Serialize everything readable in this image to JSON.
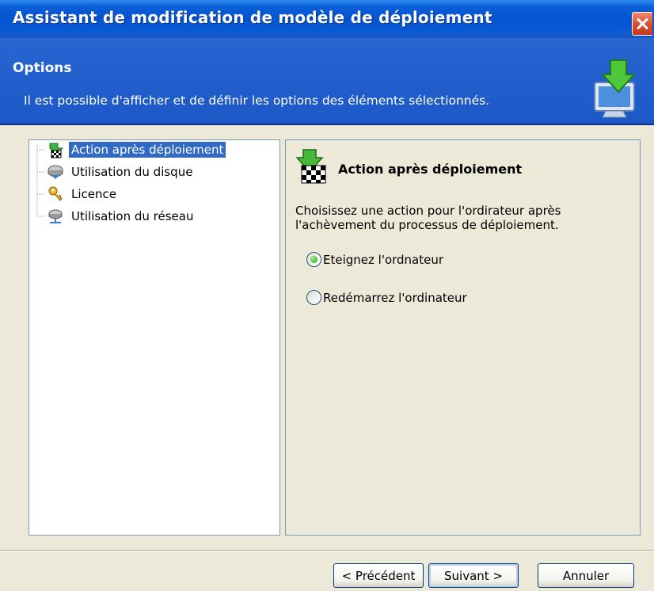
{
  "window": {
    "title": "Assistant de modification de modèle de déploiement"
  },
  "header": {
    "title": "Options",
    "description": "Il est possible d'afficher et de définir les options des éléments sélectionnés."
  },
  "tree": {
    "items": [
      {
        "label": "Action après déploiement",
        "icon": "checkered-flag-icon",
        "selected": true
      },
      {
        "label": "Utilisation du disque",
        "icon": "disk-icon",
        "selected": false
      },
      {
        "label": "Licence",
        "icon": "key-icon",
        "selected": false
      },
      {
        "label": "Utilisation du réseau",
        "icon": "network-icon",
        "selected": false
      }
    ]
  },
  "detail": {
    "title": "Action après déploiement",
    "description": "Choisissez une action pour l'ordirateur après l'achèvement du processus de déploiement.",
    "options": [
      {
        "label": "Eteignez l'ordnateur",
        "checked": true
      },
      {
        "label": "Redémarrez l'ordinateur",
        "checked": false
      }
    ]
  },
  "buttons": {
    "back": "< Précédent",
    "next": "Suivant >",
    "cancel": "Annuler"
  },
  "colors": {
    "titlebar": "#0553d0",
    "header": "#1f5cc8",
    "selection": "#316ac5",
    "dialog": "#ece9d8"
  }
}
